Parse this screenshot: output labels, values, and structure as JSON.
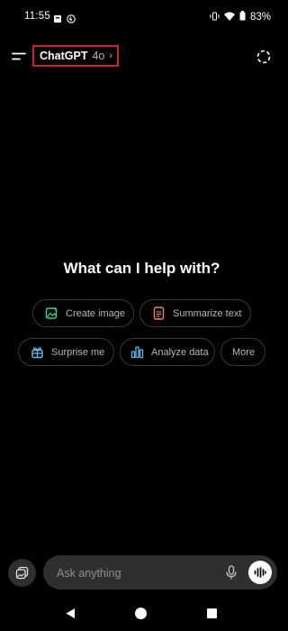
{
  "status_bar": {
    "time": "11:55",
    "battery": "83%",
    "icons_left": [
      "notification-icon",
      "accessibility-icon"
    ],
    "icons_right": [
      "vibrate-icon",
      "wifi-icon",
      "battery-icon"
    ]
  },
  "header": {
    "model_name": "ChatGPT",
    "model_version": "4o",
    "chevron": "›",
    "highlight_color": "#c8232f"
  },
  "main": {
    "headline": "What can I help with?"
  },
  "suggestions": [
    {
      "label": "Create image",
      "icon": "image-icon",
      "color": "#3ecf8e"
    },
    {
      "label": "Summarize text",
      "icon": "document-icon",
      "color": "#e9895a"
    },
    {
      "label": "Surprise me",
      "icon": "gift-icon",
      "color": "#6ab8e8"
    },
    {
      "label": "Analyze data",
      "icon": "chart-icon",
      "color": "#6ab8e8"
    },
    {
      "label": "More"
    }
  ],
  "composer": {
    "placeholder": "Ask anything"
  },
  "colors": {
    "background": "#000000",
    "surface": "#2f2f2f",
    "chip_border": "#3a3a3a"
  }
}
